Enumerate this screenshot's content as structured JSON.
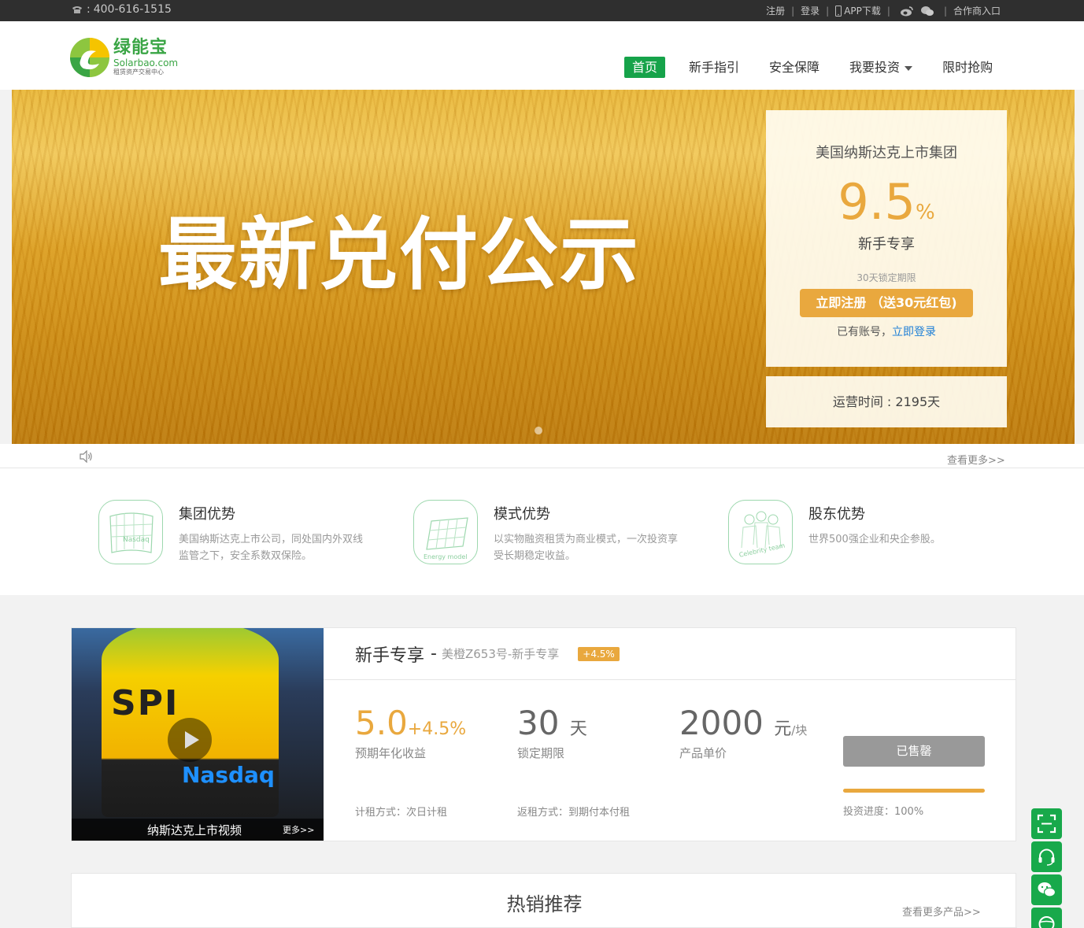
{
  "topbar": {
    "phone": "400-616-1515",
    "links": [
      "注册",
      "登录",
      "APP下载",
      "合作商入口"
    ]
  },
  "header": {
    "logo_cn": "绿能宝",
    "logo_en": "Solarbao.com",
    "logo_sub": "租赁资产交易中心",
    "nav": [
      {
        "label": "首页",
        "active": true
      },
      {
        "label": "新手指引"
      },
      {
        "label": "安全保障"
      },
      {
        "label": "我要投资"
      },
      {
        "label": "限时抢购"
      }
    ]
  },
  "banner": {
    "headline": "最新兑付公示",
    "card": {
      "org": "美国纳斯达克上市集团",
      "rate": "9.5",
      "rate_unit": "%",
      "tag": "新手专享",
      "term": "30天锁定期限",
      "register_label": "立即注册 （送30元红包)",
      "has_account": "已有账号，",
      "login_link": "立即登录"
    },
    "operation": "运营时间 : 2195天"
  },
  "notice": {
    "more": "查看更多>>"
  },
  "advantages": [
    {
      "title": "集团优势",
      "desc": "美国纳斯达克上市公司，同处国内外双线监管之下，安全系数双保险。",
      "icon_label": "Nasdaq"
    },
    {
      "title": "模式优势",
      "desc": "以实物融资租赁为商业模式，一次投资享受长期稳定收益。",
      "icon_label": "Energy model"
    },
    {
      "title": "股东优势",
      "desc": "世界500强企业和央企参股。",
      "icon_label": "Celebrity team"
    }
  ],
  "product": {
    "video_title": "纳斯达克上市视频",
    "video_more": "更多>>",
    "video_spi": "SPI",
    "video_nasdaq": "Nasdaq",
    "title": "新手专享",
    "dash": "-",
    "subtitle": "美橙Z653号-新手专享",
    "badge": "+4.5%",
    "yield_value": "5.0",
    "yield_extra": "+4.5%",
    "yield_label": "预期年化收益",
    "term_value": "30",
    "term_unit": "天",
    "term_label": "锁定期限",
    "price_value": "2000",
    "price_unit": "元",
    "price_unit2": "/块",
    "price_label": "产品单价",
    "sold_label": "已售罄",
    "progress_percent": 100,
    "progress_label": "投资进度：100%",
    "rent_method": "计租方式：次日计租",
    "return_method": "返租方式：到期付本付租"
  },
  "hot": {
    "title": "热销推荐",
    "more": "查看更多产品>>"
  },
  "colors": {
    "brand_green": "#16a34a",
    "accent_orange": "#e9a83e",
    "link_blue": "#1e7fd6"
  }
}
